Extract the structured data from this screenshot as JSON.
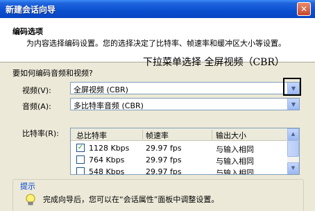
{
  "window": {
    "title": "新建会话向导",
    "close_glyph": "✕"
  },
  "header": {
    "title": "编码选项",
    "description": "为内容选择编码设置。您的选择决定了比特率、帧速率和缓冲区大小等设置。"
  },
  "annotation": "下拉菜单选择 全屏视频（CBR）",
  "section": {
    "label": "要如何编码音频和视频?"
  },
  "video": {
    "label": "视频(V):",
    "value": "全屏视频 (CBR)"
  },
  "audio": {
    "label": "音频(A):",
    "value": "多比特率音频 (CBR)"
  },
  "bitrate": {
    "label": "比特率(R):",
    "columns": [
      "总比特率",
      "帧速率",
      "输出大小"
    ],
    "rows": [
      {
        "checked": true,
        "bitrate": "1128 Kbps",
        "fps": "29.97 fps",
        "size": "与输入相同"
      },
      {
        "checked": false,
        "bitrate": "764 Kbps",
        "fps": "29.97 fps",
        "size": "与输入相同"
      },
      {
        "checked": false,
        "bitrate": "548 Kbps",
        "fps": "29.97 fps",
        "size": "与输入相同"
      }
    ]
  },
  "tips": {
    "title": "提示",
    "text": "完成向导后，您可以在“会话属性”面板中调整设置。"
  },
  "icons": {
    "dropdown": "chevron-down-icon",
    "tips": "lightbulb-icon",
    "close": "close-icon"
  }
}
